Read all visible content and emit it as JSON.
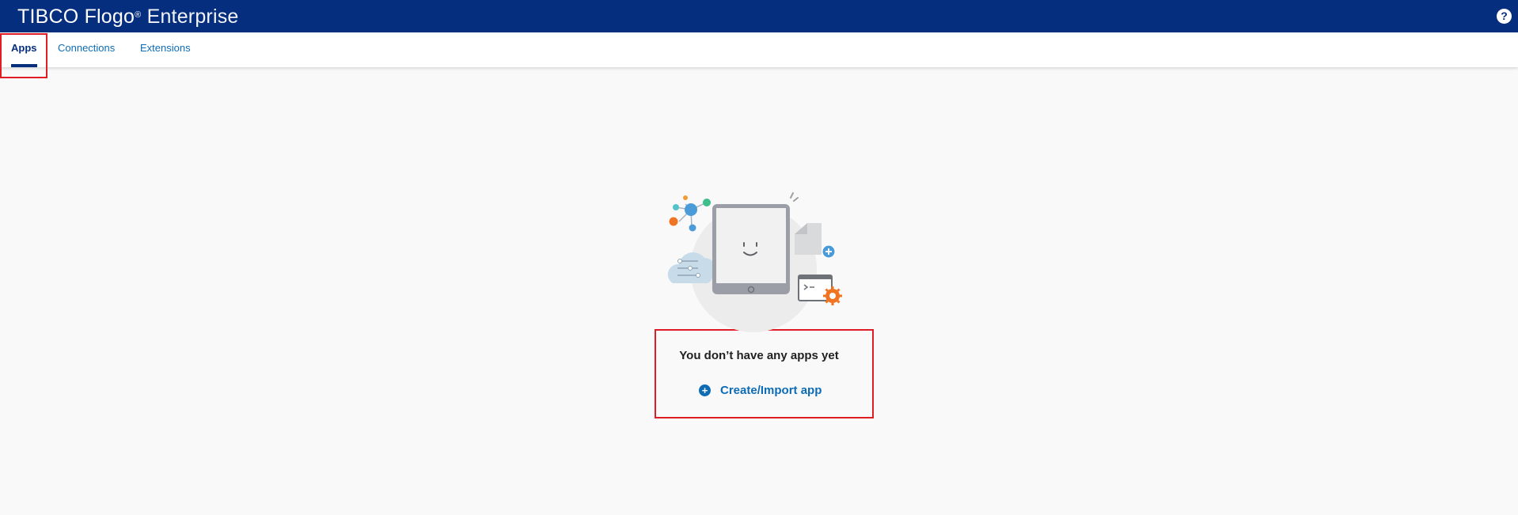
{
  "header": {
    "brand_main": "TIBC",
    "brand_o": "O",
    "brand_product": "Flogo",
    "brand_edition": "Enterprise",
    "help_label": "?"
  },
  "nav": {
    "tabs": [
      {
        "label": "Apps",
        "active": true
      },
      {
        "label": "Connections",
        "active": false
      },
      {
        "label": "Extensions",
        "active": false
      }
    ]
  },
  "empty_state": {
    "message": "You don’t have any apps yet",
    "action_label": "Create/Import app",
    "action_icon": "plus-circle-icon"
  },
  "colors": {
    "header_bg": "#062e7e",
    "link": "#0e6cb5",
    "highlight": "#e01d26",
    "page_bg": "#f9f9f9"
  }
}
